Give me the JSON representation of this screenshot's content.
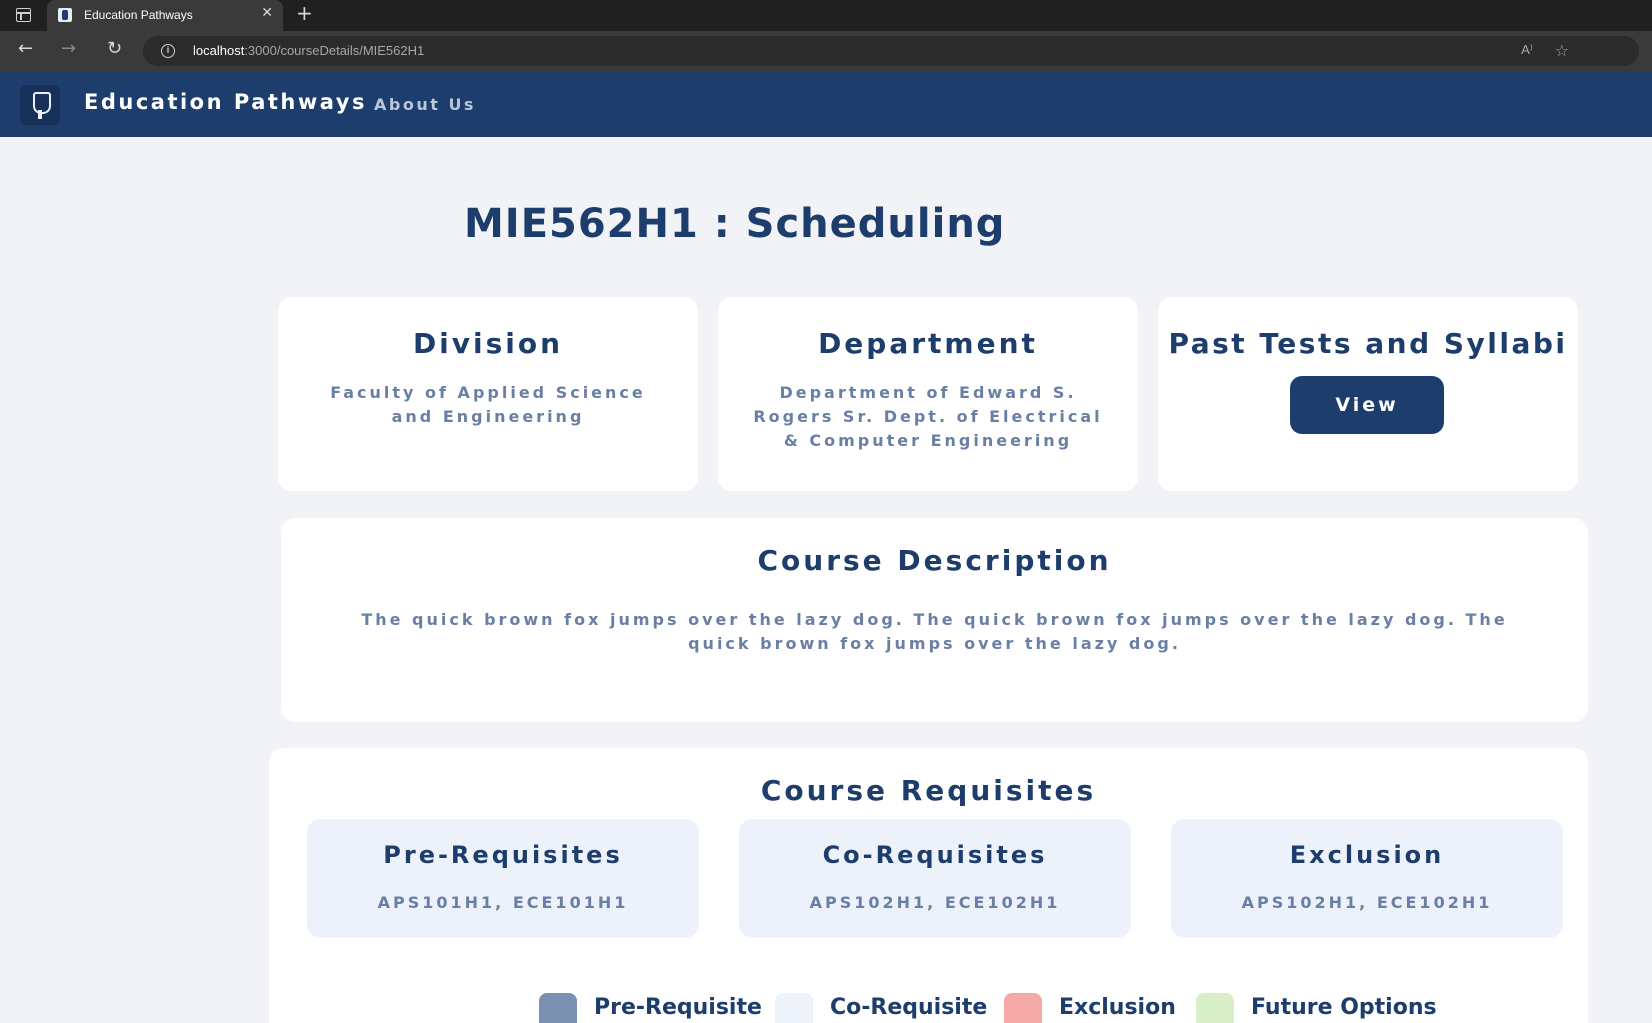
{
  "browser": {
    "tab_title": "Education Pathways",
    "tab_close": "✕",
    "new_tab": "+",
    "url_host": "localhost",
    "url_path": ":3000/courseDetails/MIE562H1",
    "info_icon": "i",
    "read_aloud": "A⁾",
    "favorite_icon": "☆"
  },
  "nav": {
    "brand": "Education Pathways",
    "about_link": "About Us"
  },
  "course": {
    "title": "MIE562H1 : Scheduling"
  },
  "division": {
    "heading": "Division",
    "value": "Faculty of Applied Science and Engineering"
  },
  "department": {
    "heading": "Department",
    "value": "Department of Edward S. Rogers Sr. Dept. of Electrical & Computer Engineering"
  },
  "tests": {
    "heading": "Past Tests and Syllabi",
    "button_label": "View"
  },
  "description": {
    "heading": "Course Description",
    "text": "The quick brown fox jumps over the lazy dog. The quick brown fox jumps over the lazy dog. The quick brown fox jumps over the lazy dog."
  },
  "requisites": {
    "heading": "Course Requisites",
    "pre": {
      "heading": "Pre-Requisites",
      "value": "APS101H1, ECE101H1"
    },
    "co": {
      "heading": "Co-Requisites",
      "value": "APS102H1, ECE102H1"
    },
    "exclusion": {
      "heading": "Exclusion",
      "value": "APS102H1, ECE102H1"
    }
  },
  "legend": [
    {
      "label": "Pre-Requisite",
      "color": "#7b8fb0"
    },
    {
      "label": "Co-Requisite",
      "color": "#eef3fb"
    },
    {
      "label": "Exclusion",
      "color": "#f4a9a8"
    },
    {
      "label": "Future Options",
      "color": "#d8efc9"
    }
  ],
  "colors": {
    "primary": "#1d3d6d",
    "muted_text": "#6a7fa4",
    "page_background": "#f2f3f6"
  }
}
